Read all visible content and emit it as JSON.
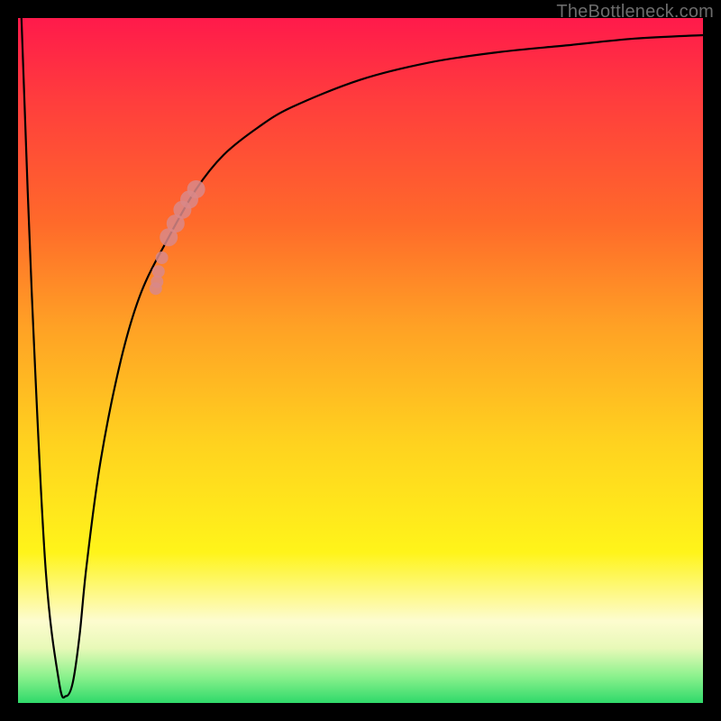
{
  "watermark": "TheBottleneck.com",
  "colors": {
    "frame": "#000000",
    "curve": "#000000",
    "marker": "#d98888",
    "watermark": "#6c6c6c"
  },
  "chart_data": {
    "type": "line",
    "title": "",
    "xlabel": "",
    "ylabel": "",
    "xlim": [
      0,
      100
    ],
    "ylim": [
      0,
      100
    ],
    "grid": false,
    "legend": false,
    "series": [
      {
        "name": "bottleneck-curve",
        "x": [
          0.5,
          2,
          4,
          6,
          7,
          8,
          9,
          10,
          12,
          15,
          18,
          22,
          26,
          30,
          35,
          40,
          50,
          60,
          70,
          80,
          90,
          100
        ],
        "y": [
          100,
          60,
          20,
          3,
          1,
          3,
          10,
          20,
          35,
          50,
          60,
          68,
          75,
          80,
          84,
          87,
          91,
          93.5,
          95,
          96,
          97,
          97.5
        ]
      }
    ],
    "markers": [
      {
        "name": "highlight-segment",
        "points": [
          {
            "x": 22,
            "y": 68
          },
          {
            "x": 23,
            "y": 70
          },
          {
            "x": 24,
            "y": 72
          },
          {
            "x": 25,
            "y": 73.5
          },
          {
            "x": 26,
            "y": 75
          },
          {
            "x": 21,
            "y": 65
          },
          {
            "x": 20.5,
            "y": 63
          },
          {
            "x": 20.3,
            "y": 61.5
          },
          {
            "x": 20.1,
            "y": 60.5
          }
        ],
        "color": "#d98888",
        "size_main": 10,
        "size_tail": 7
      }
    ],
    "background_gradient": {
      "top": "#ff1a4b",
      "mid1": "#ffa125",
      "mid2": "#fff41a",
      "bottom": "#2fd96a"
    }
  }
}
